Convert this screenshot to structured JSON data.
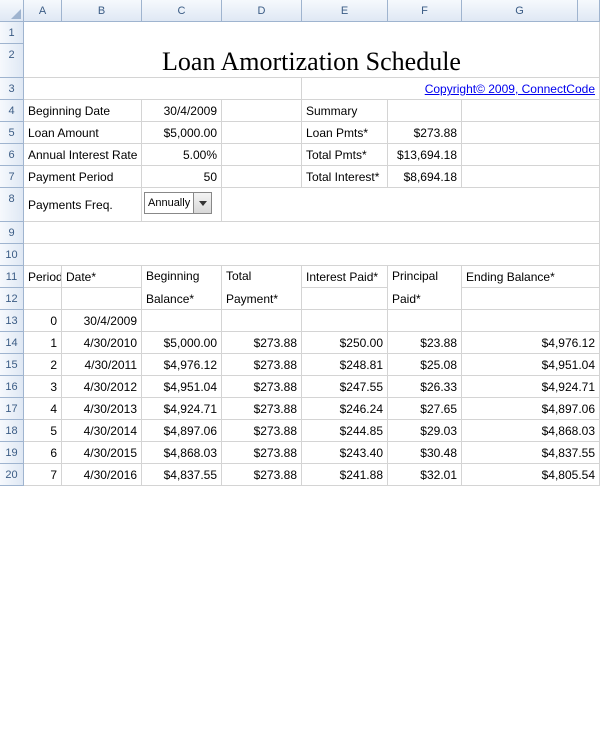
{
  "columns": [
    "A",
    "B",
    "C",
    "D",
    "E",
    "F",
    "G"
  ],
  "title": "Loan Amortization Schedule",
  "copyright": "Copyright© 2009, ConnectCode",
  "inputs": {
    "beginning_date_label": "Beginning Date",
    "beginning_date": "30/4/2009",
    "loan_amount_label": "Loan Amount",
    "loan_amount": "$5,000.00",
    "annual_rate_label": "Annual Interest Rate",
    "annual_rate": "5.00%",
    "payment_period_label": "Payment Period",
    "payment_period": "50",
    "payments_freq_label": "Payments Freq.",
    "payments_freq": "Annually"
  },
  "summary": {
    "heading": "Summary",
    "loan_pmts_label": "Loan Pmts*",
    "loan_pmts": "$273.88",
    "total_pmts_label": "Total Pmts*",
    "total_pmts": "$13,694.18",
    "total_interest_label": "Total Interest*",
    "total_interest": "$8,694.18"
  },
  "table_headers": {
    "period": "Period*",
    "date": "Date*",
    "beg_bal": "Beginning Balance*",
    "total_pmt": "Total Payment*",
    "interest": "Interest Paid*",
    "principal": "Principal Paid*",
    "end_bal": "Ending Balance*"
  },
  "rows": [
    {
      "period": "0",
      "date": "30/4/2009",
      "beg": "",
      "pmt": "",
      "int": "",
      "prin": "",
      "end": ""
    },
    {
      "period": "1",
      "date": "4/30/2010",
      "beg": "$5,000.00",
      "pmt": "$273.88",
      "int": "$250.00",
      "prin": "$23.88",
      "end": "$4,976.12"
    },
    {
      "period": "2",
      "date": "4/30/2011",
      "beg": "$4,976.12",
      "pmt": "$273.88",
      "int": "$248.81",
      "prin": "$25.08",
      "end": "$4,951.04"
    },
    {
      "period": "3",
      "date": "4/30/2012",
      "beg": "$4,951.04",
      "pmt": "$273.88",
      "int": "$247.55",
      "prin": "$26.33",
      "end": "$4,924.71"
    },
    {
      "period": "4",
      "date": "4/30/2013",
      "beg": "$4,924.71",
      "pmt": "$273.88",
      "int": "$246.24",
      "prin": "$27.65",
      "end": "$4,897.06"
    },
    {
      "period": "5",
      "date": "4/30/2014",
      "beg": "$4,897.06",
      "pmt": "$273.88",
      "int": "$244.85",
      "prin": "$29.03",
      "end": "$4,868.03"
    },
    {
      "period": "6",
      "date": "4/30/2015",
      "beg": "$4,868.03",
      "pmt": "$273.88",
      "int": "$243.40",
      "prin": "$30.48",
      "end": "$4,837.55"
    },
    {
      "period": "7",
      "date": "4/30/2016",
      "beg": "$4,837.55",
      "pmt": "$273.88",
      "int": "$241.88",
      "prin": "$32.01",
      "end": "$4,805.54"
    }
  ]
}
